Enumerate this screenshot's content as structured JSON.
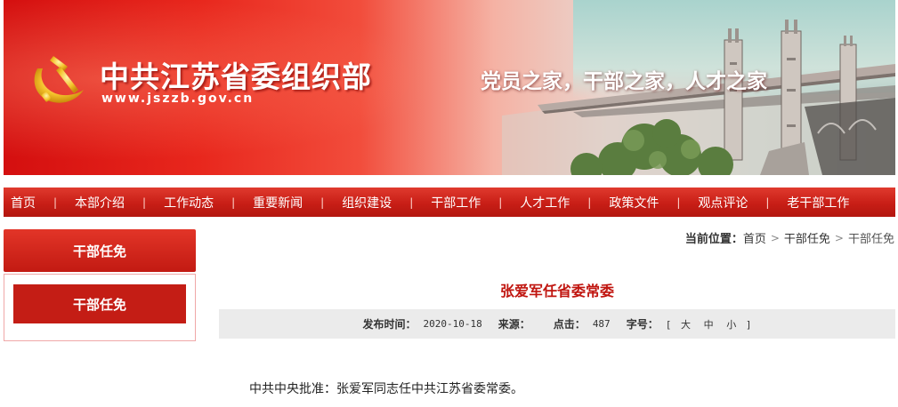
{
  "header": {
    "title": "中共江苏省委组织部",
    "url": "www.jszzb.gov.cn",
    "slogan": "党员之家，干部之家，人才之家",
    "emblem_icon": "party-emblem-icon"
  },
  "nav": {
    "items": [
      "首页",
      "本部介绍",
      "工作动态",
      "重要新闻",
      "组织建设",
      "干部工作",
      "人才工作",
      "政策文件",
      "观点评论",
      "老干部工作"
    ],
    "separator": "|"
  },
  "sidebar": {
    "heading": "干部任免",
    "items": [
      "干部任免"
    ]
  },
  "breadcrumb": {
    "label": "当前位置：",
    "links": [
      "首页",
      "干部任免"
    ],
    "current": "干部任免"
  },
  "article": {
    "title": "张爱军任省委常委",
    "meta": {
      "publish_label": "发布时间：",
      "publish_date": "2020-10-18",
      "source_label": "来源：",
      "source_value": "",
      "clicks_label": "点击：",
      "clicks_value": "487",
      "fontsize_label": "字号：",
      "fontsize_open": "[",
      "fontsize_options": [
        "大",
        "中",
        "小"
      ],
      "fontsize_close": "]"
    },
    "body": "中共中央批准：张爱军同志任中共江苏省委常委。"
  },
  "colors": {
    "brand_red": "#c81e16",
    "title_red": "#c0150f",
    "meta_bg": "#ebebeb"
  }
}
